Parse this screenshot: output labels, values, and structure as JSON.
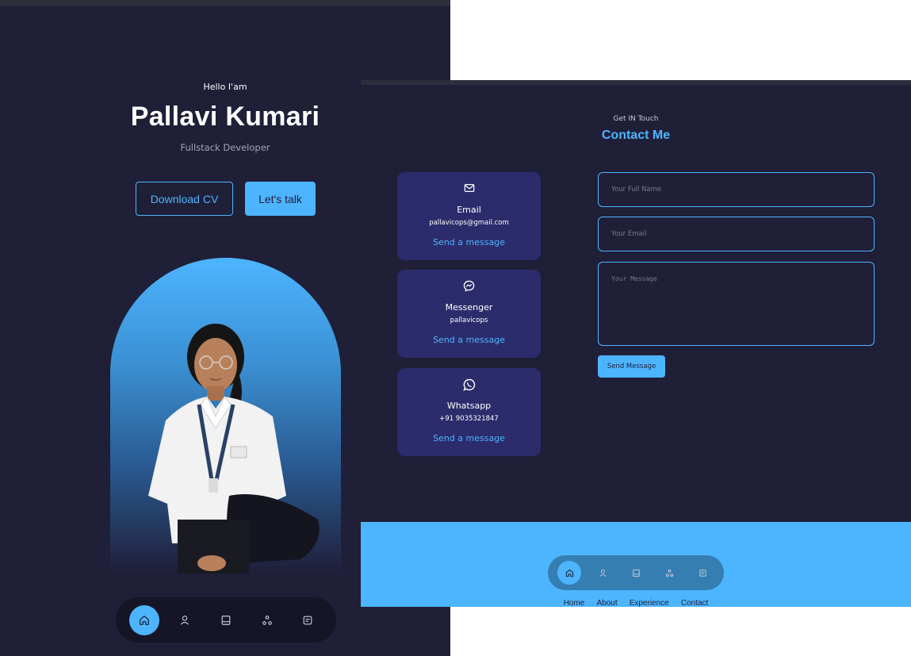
{
  "hero": {
    "greeting": "Hello I'am",
    "name": "Pallavi Kumari",
    "role": "Fullstack Developer",
    "download_cv_label": "Download CV",
    "lets_talk_label": "Let's talk"
  },
  "nav": {
    "items": [
      {
        "icon": "home-icon",
        "active": true
      },
      {
        "icon": "user-icon",
        "active": false
      },
      {
        "icon": "book-icon",
        "active": false
      },
      {
        "icon": "services-icon",
        "active": false
      },
      {
        "icon": "message-icon",
        "active": false
      }
    ]
  },
  "contact": {
    "subtitle": "Get IN Touch",
    "title": "Contact Me",
    "options": [
      {
        "icon": "email-icon",
        "title": "Email",
        "value": "pallavicops@gmail.com",
        "link": "Send a message"
      },
      {
        "icon": "messenger-icon",
        "title": "Messenger",
        "value": "pallavicops",
        "link": "Send a message"
      },
      {
        "icon": "whatsapp-icon",
        "title": "Whatsapp",
        "value": "+91 9035321847",
        "link": "Send a message"
      }
    ],
    "form": {
      "name_placeholder": "Your Full Name",
      "email_placeholder": "Your Email",
      "message_placeholder": "Your Message",
      "send_label": "Send Message"
    }
  },
  "footer": {
    "links": [
      "Home",
      "About",
      "Experience",
      "Contact"
    ]
  },
  "colors": {
    "background": "#1f1f38",
    "primary": "#4db5ff",
    "card": "#2c2c6c",
    "white": "#ffffff"
  }
}
